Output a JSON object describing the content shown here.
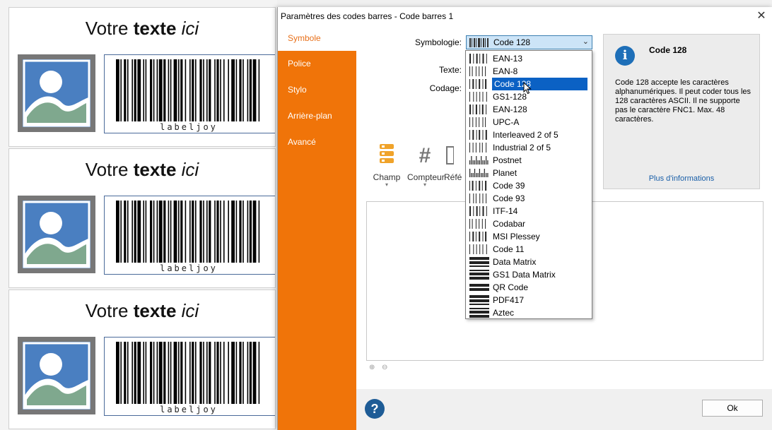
{
  "labels": {
    "title_prefix": "Votre",
    "title_bold": "texte",
    "title_italic": "ici",
    "barcode_text": "labeljoy"
  },
  "dialog": {
    "title": "Paramètres des codes barres - Code barres 1",
    "close": "✕"
  },
  "sidebar": {
    "items": [
      "Symbole",
      "Police",
      "Stylo",
      "Arrière-plan",
      "Avancé"
    ]
  },
  "form": {
    "symbologie_label": "Symbologie:",
    "texte_label": "Texte:",
    "codage_label": "Codage:",
    "selected_symbology": "Code 128"
  },
  "toolbar": {
    "champ": "Champ",
    "compteur": "Compteur",
    "reference_partial": "Réfé"
  },
  "info": {
    "title": "Code 128",
    "description": "Code 128 accepte les caractères alphanumériques. Il peut coder tous les 128 caractères ASCII. Il ne supporte pas le caractère FNC1. Max. 48 caractères.",
    "link": "Plus d'informations"
  },
  "footer": {
    "ok": "Ok",
    "help": "?"
  },
  "dropdown": {
    "selected_index": 2,
    "items": [
      "EAN-13",
      "EAN-8",
      "Code 128",
      "GS1-128",
      "EAN-128",
      "UPC-A",
      "Interleaved 2 of 5",
      "Industrial 2 of 5",
      "Postnet",
      "Planet",
      "Code 39",
      "Code 93",
      "ITF-14",
      "Codabar",
      "MSI Plessey",
      "Code 11",
      "Data Matrix",
      "GS1 Data Matrix",
      "QR Code",
      "PDF417",
      "Aztec"
    ]
  },
  "colors": {
    "accent_orange": "#f07409",
    "selection_blue": "#0b61c4",
    "link_blue": "#1a5fa8"
  }
}
